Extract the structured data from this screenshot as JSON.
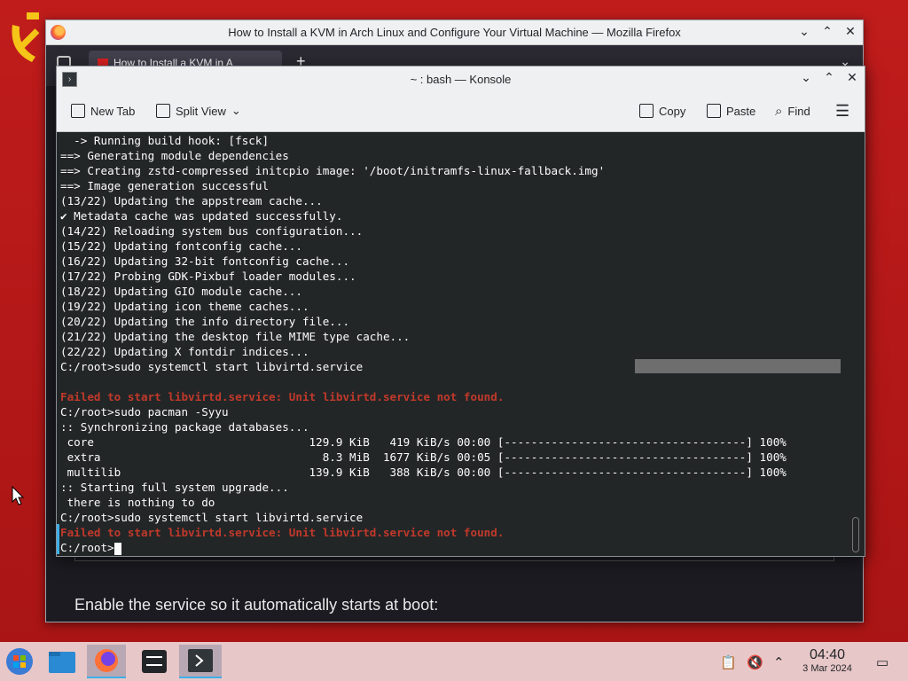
{
  "firefox": {
    "title": "How to Install a KVM in Arch Linux and Configure Your Virtual Machine — Mozilla Firefox",
    "tab_label": "How to Install a KVM in A",
    "content_text": "Enable the service so it automatically starts at boot:"
  },
  "konsole": {
    "title": "~ : bash — Konsole",
    "toolbar": {
      "new_tab": "New Tab",
      "split_view": "Split View",
      "copy": "Copy",
      "paste": "Paste",
      "find": "Find"
    },
    "lines": [
      {
        "text": "  -> Running build hook: [fsck]",
        "type": "normal"
      },
      {
        "text": "==> Generating module dependencies",
        "type": "normal"
      },
      {
        "text": "==> Creating zstd-compressed initcpio image: '/boot/initramfs-linux-fallback.img'",
        "type": "normal"
      },
      {
        "text": "==> Image generation successful",
        "type": "normal"
      },
      {
        "text": "(13/22) Updating the appstream cache...",
        "type": "normal"
      },
      {
        "text": "✔ Metadata cache was updated successfully.",
        "type": "normal"
      },
      {
        "text": "(14/22) Reloading system bus configuration...",
        "type": "normal"
      },
      {
        "text": "(15/22) Updating fontconfig cache...",
        "type": "normal"
      },
      {
        "text": "(16/22) Updating 32-bit fontconfig cache...",
        "type": "normal"
      },
      {
        "text": "(17/22) Probing GDK-Pixbuf loader modules...",
        "type": "normal"
      },
      {
        "text": "(18/22) Updating GIO module cache...",
        "type": "normal"
      },
      {
        "text": "(19/22) Updating icon theme caches...",
        "type": "normal"
      },
      {
        "text": "(20/22) Updating the info directory file...",
        "type": "normal"
      },
      {
        "text": "(21/22) Updating the desktop file MIME type cache...",
        "type": "normal"
      },
      {
        "text": "(22/22) Updating X fontdir indices...",
        "type": "normal"
      },
      {
        "text": "C:/root>sudo systemctl start libvirtd.service",
        "type": "normal"
      },
      {
        "text": "",
        "type": "normal"
      },
      {
        "text": "Failed to start libvirtd.service: Unit libvirtd.service not found.",
        "type": "err"
      },
      {
        "text": "C:/root>sudo pacman -Syyu",
        "type": "normal"
      },
      {
        "text": ":: Synchronizing package databases...",
        "type": "normal"
      },
      {
        "text": " core                                129.9 KiB   419 KiB/s 00:00 [------------------------------------] 100%",
        "type": "normal"
      },
      {
        "text": " extra                                 8.3 MiB  1677 KiB/s 00:05 [------------------------------------] 100%",
        "type": "normal"
      },
      {
        "text": " multilib                            139.9 KiB   388 KiB/s 00:00 [------------------------------------] 100%",
        "type": "normal"
      },
      {
        "text": ":: Starting full system upgrade...",
        "type": "normal"
      },
      {
        "text": " there is nothing to do",
        "type": "normal"
      },
      {
        "text": "C:/root>sudo systemctl start libvirtd.service",
        "type": "normal"
      },
      {
        "text": "Failed to start libvirtd.service: Unit libvirtd.service not found.",
        "type": "err"
      }
    ],
    "prompt": "C:/root>"
  },
  "taskbar": {
    "time": "04:40",
    "date": "3 Mar 2024",
    "items": [
      "start-menu-icon",
      "file-manager-icon",
      "firefox-icon",
      "system-settings-icon",
      "konsole-icon"
    ]
  },
  "colors": {
    "desktop": "#b01818",
    "error": "#c0392b",
    "accent": "#3daee9"
  }
}
